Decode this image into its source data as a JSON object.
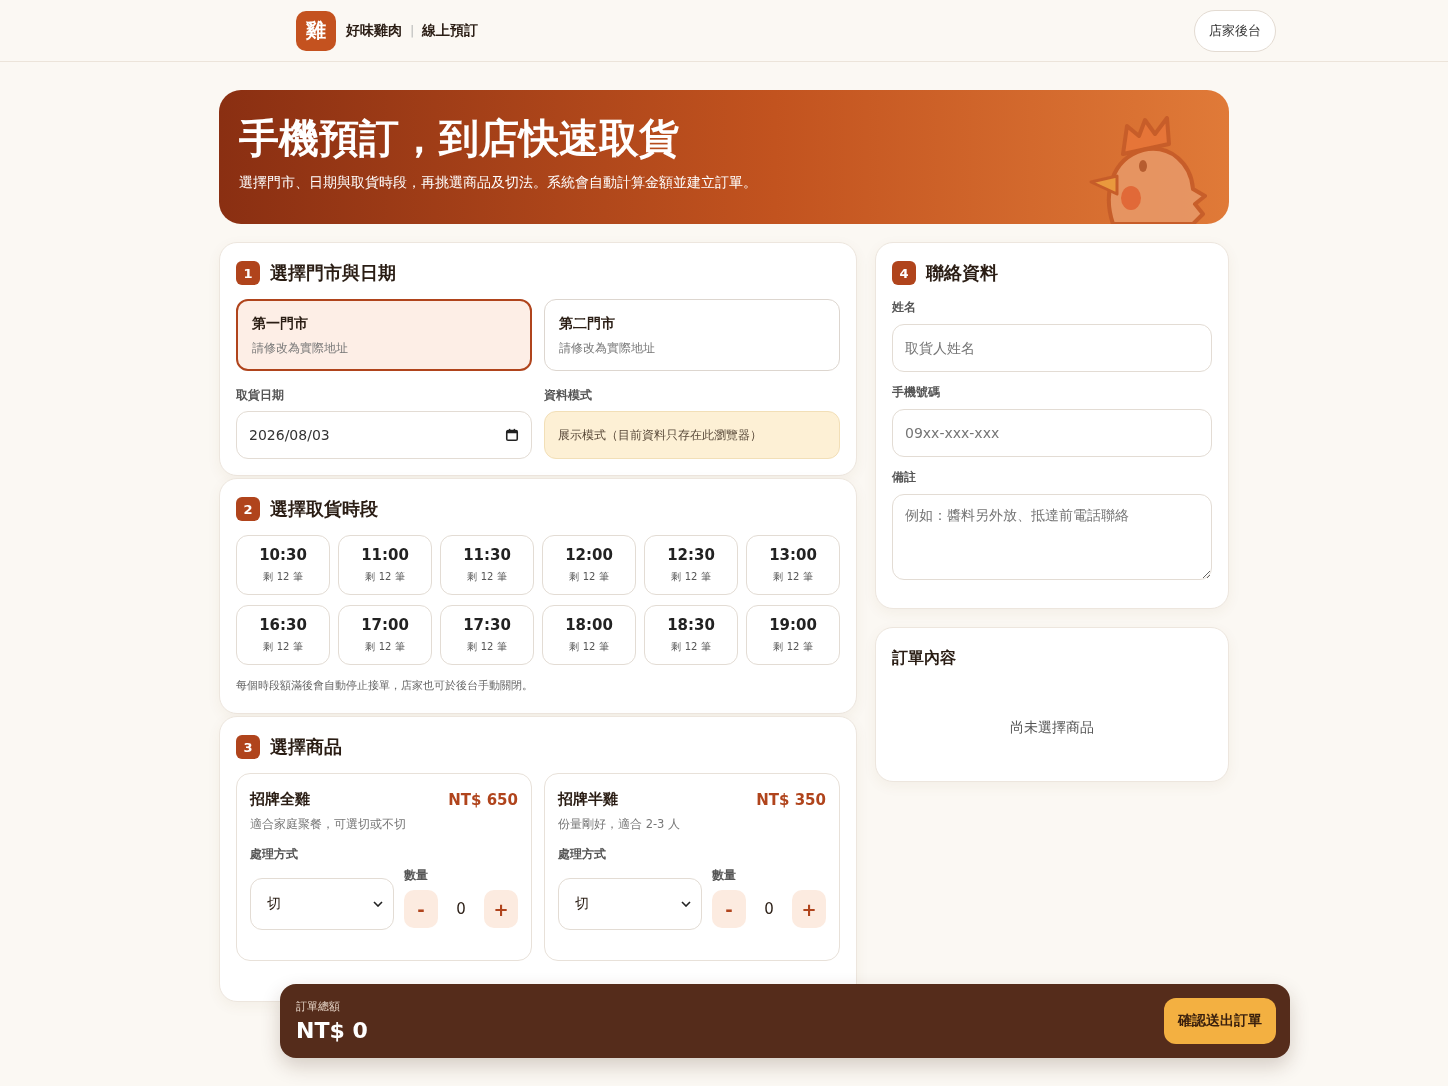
{
  "header": {
    "logo": "雞",
    "brand": "好味雞肉",
    "divider": "|",
    "subtitle": "線上預訂",
    "admin_button": "店家後台"
  },
  "hero": {
    "title": "手機預訂，到店快速取貨",
    "subtitle": "選擇門市、日期與取貨時段，再挑選商品及切法。系統會自動計算金額並建立訂單。"
  },
  "section_store": {
    "number": "1",
    "title": "選擇門市與日期",
    "stores": [
      {
        "name": "第一門市",
        "address": "請修改為實際地址",
        "selected": true
      },
      {
        "name": "第二門市",
        "address": "請修改為實際地址",
        "selected": false
      }
    ],
    "date_label": "取貨日期",
    "date_value": "2026/08/03",
    "mode_label": "資料模式",
    "mode_text": "展示模式（目前資料只存在此瀏覽器）"
  },
  "section_time": {
    "number": "2",
    "title": "選擇取貨時段",
    "slots": [
      {
        "time": "10:30",
        "remaining": "剩 12 筆",
        "selected": false
      },
      {
        "time": "11:00",
        "remaining": "剩 12 筆",
        "selected": false
      },
      {
        "time": "11:30",
        "remaining": "剩 12 筆",
        "selected": false
      },
      {
        "time": "12:00",
        "remaining": "剩 12 筆",
        "selected": false
      },
      {
        "time": "12:30",
        "remaining": "剩 12 筆",
        "selected": false
      },
      {
        "time": "13:00",
        "remaining": "剩 12 筆",
        "selected": false
      },
      {
        "time": "16:30",
        "remaining": "剩 12 筆",
        "selected": false
      },
      {
        "time": "17:00",
        "remaining": "剩 12 筆",
        "selected": false
      },
      {
        "time": "17:30",
        "remaining": "剩 12 筆",
        "selected": false
      },
      {
        "time": "18:00",
        "remaining": "剩 12 筆",
        "selected": false
      },
      {
        "time": "18:30",
        "remaining": "剩 12 筆",
        "selected": false
      },
      {
        "time": "19:00",
        "remaining": "剩 12 筆",
        "selected": false
      }
    ],
    "note": "每個時段額滿後會自動停止接單，店家也可於後台手動關閉。"
  },
  "section_products": {
    "number": "3",
    "title": "選擇商品",
    "products": [
      {
        "name": "招牌全雞",
        "price": "NT$ 650",
        "description": "適合家庭聚餐，可選切或不切",
        "method_label": "處理方式",
        "method_value": "切",
        "qty_label": "數量",
        "minus": "-",
        "qty": "0",
        "plus": "+"
      },
      {
        "name": "招牌半雞",
        "price": "NT$ 350",
        "description": "份量剛好，適合 2-3 人",
        "method_label": "處理方式",
        "method_value": "切",
        "qty_label": "數量",
        "minus": "-",
        "qty": "0",
        "plus": "+"
      }
    ]
  },
  "section_contact": {
    "number": "4",
    "title": "聯絡資料",
    "fields": [
      {
        "kind": "input",
        "label": "姓名",
        "placeholder": "取貨人姓名"
      },
      {
        "kind": "input",
        "label": "手機號碼",
        "placeholder": "09xx-xxx-xxx"
      },
      {
        "kind": "textarea",
        "label": "備註",
        "placeholder": "例如：醬料另外放、抵達前電話聯絡"
      }
    ]
  },
  "order_summary": {
    "title": "訂單內容",
    "empty_text": "尚未選擇商品"
  },
  "footer_bar": {
    "total_label": "訂單總額",
    "total": "NT$ 0",
    "submit": "確認送出訂單"
  }
}
